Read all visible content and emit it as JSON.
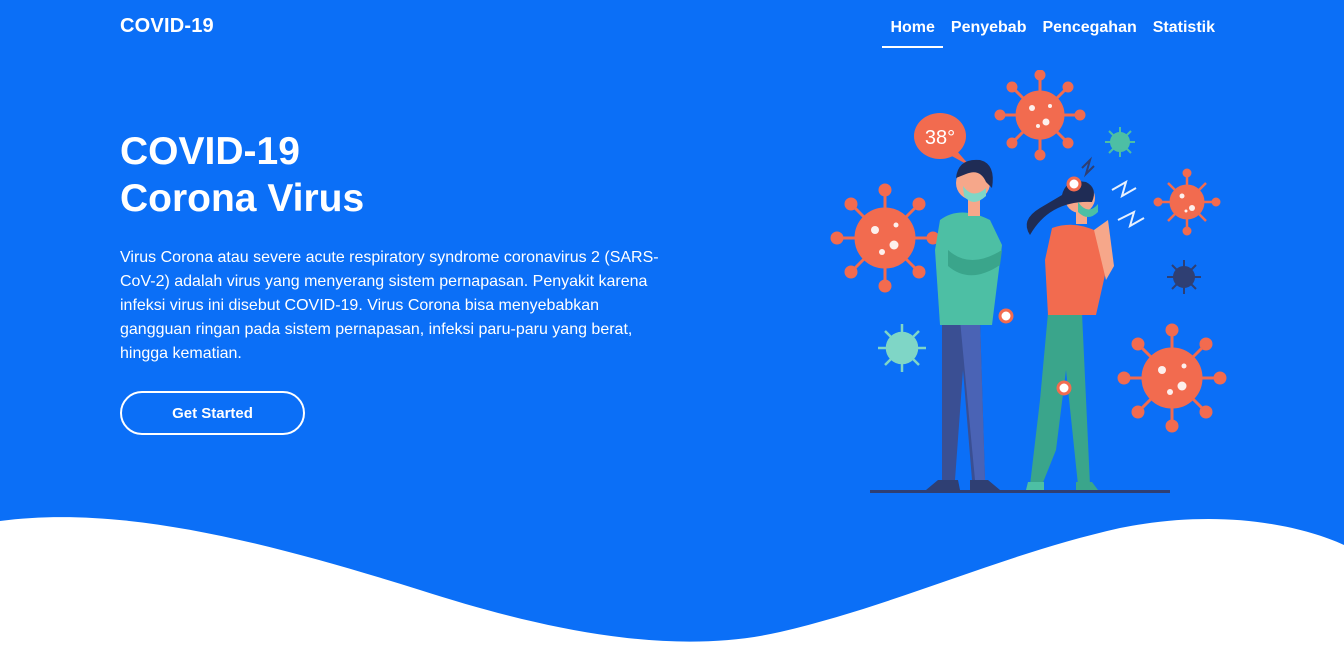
{
  "brand": {
    "name": "COVID-19"
  },
  "nav": {
    "items": [
      {
        "label": "Home",
        "active": true
      },
      {
        "label": "Penyebab",
        "active": false
      },
      {
        "label": "Pencegahan",
        "active": false
      },
      {
        "label": "Statistik",
        "active": false
      }
    ]
  },
  "hero": {
    "title_line1": "COVID-19",
    "title_line2": "Corona Virus",
    "description": "Virus Corona atau severe acute respiratory syndrome coronavirus 2 (SARS-CoV-2) adalah virus yang menyerang sistem pernapasan. Penyakit karena infeksi virus ini disebut COVID-19. Virus Corona bisa menyebabkan gangguan ringan pada sistem pernapasan, infeksi paru-paru yang berat, hingga kematian.",
    "cta_label": "Get Started",
    "illustration": {
      "temperature_label": "38°"
    }
  },
  "colors": {
    "primary": "#0b6ff7",
    "virus": "#f26b4f",
    "teal": "#4dbfa4",
    "navy": "#2f3f73"
  }
}
